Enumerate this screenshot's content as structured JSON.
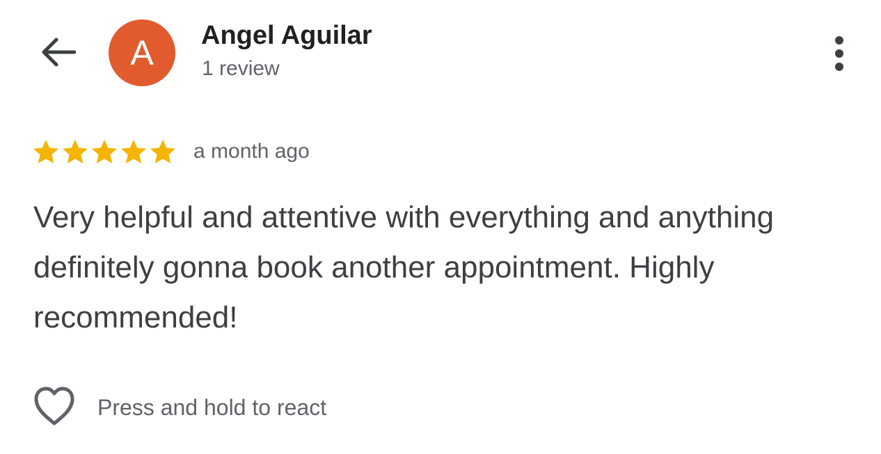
{
  "header": {
    "back_icon": "arrow-left-icon",
    "avatar_letter": "A",
    "avatar_color": "#e25b2f",
    "reviewer_name": "Angel Aguilar",
    "review_count": "1 review",
    "menu_icon": "more-vert-icon"
  },
  "review": {
    "rating": 5,
    "rating_max": 5,
    "star_color": "#f4b400",
    "time": "a month ago",
    "text": "Very helpful and attentive with everything and anything definitely gonna book another appointment. Highly recommended!"
  },
  "reaction": {
    "icon": "heart-outline-icon",
    "label": "Press and hold to react"
  }
}
